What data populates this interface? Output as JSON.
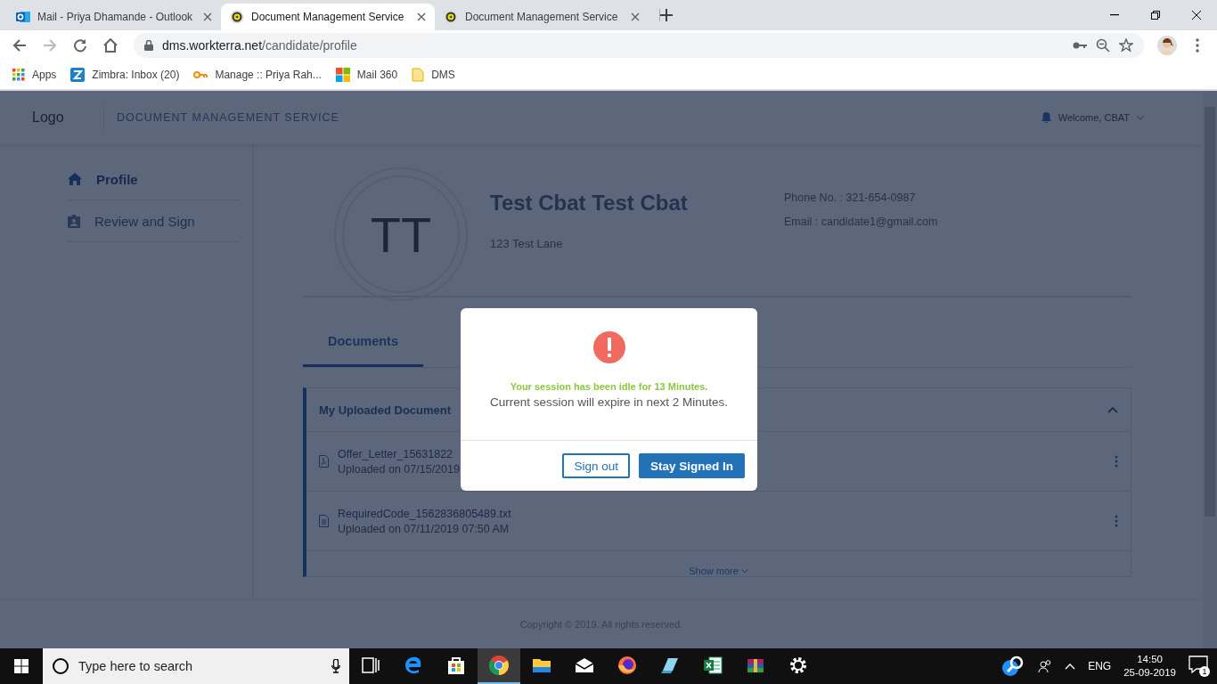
{
  "browser": {
    "tabs": [
      {
        "title": "Mail - Priya Dhamande - Outlook",
        "kind": "mail",
        "selected": false
      },
      {
        "title": "Document Management Service",
        "kind": "site",
        "selected": true
      },
      {
        "title": "Document Management Service",
        "kind": "site",
        "selected": false
      }
    ],
    "url": {
      "host": "dms.workterra.net",
      "path": "/candidate/profile"
    },
    "bookmarks": [
      {
        "label": "Apps",
        "kind": "apps"
      },
      {
        "label": "Zimbra: Inbox (20)",
        "kind": "tile"
      },
      {
        "label": "Manage :: Priya Rah...",
        "kind": "key"
      },
      {
        "label": "Mail 360",
        "kind": "squares"
      },
      {
        "label": "DMS",
        "kind": "folder"
      }
    ]
  },
  "header": {
    "logo_alt": "Logo",
    "title": "DOCUMENT MANAGEMENT SERVICE",
    "welcome": "Welcome, CBAT"
  },
  "sidebar": {
    "items": [
      {
        "label": "Profile",
        "kind": "home",
        "selected": true
      },
      {
        "label": "Review and Sign",
        "kind": "badge",
        "selected": false
      }
    ]
  },
  "profile": {
    "initials": "TT",
    "name": "Test Cbat Test Cbat",
    "address": "123 Test Lane",
    "phone": "Phone No. : 321-654-0987",
    "email": "Email : candidate1@gmail.com"
  },
  "tabs": [
    {
      "label": "Documents",
      "selected": true
    }
  ],
  "documents": {
    "title": "My Uploaded Document",
    "expanded": true,
    "files": [
      {
        "name": "Offer_Letter_15631822",
        "uploaded": "Uploaded on 07/15/2019",
        "kind": "pdf"
      },
      {
        "name": "RequiredCode_1562836805489.txt",
        "uploaded": "Uploaded on 07/11/2019 07:50 AM",
        "kind": "text"
      }
    ],
    "show_more": "Show more"
  },
  "footer": "Copyright © 2019. All rights reserved.",
  "modal": {
    "message": "Your session has been idle for 13 Minutes.",
    "detail": "Current session will expire in next 2 Minutes.",
    "buttons": [
      {
        "label": "Sign out",
        "kind": "secondary"
      },
      {
        "label": "Stay Signed In",
        "kind": "primary"
      }
    ]
  },
  "taskbar": {
    "search_placeholder": "Type here to search",
    "apps": [
      {
        "kind": "taskview",
        "selected": false
      },
      {
        "kind": "edge",
        "selected": false
      },
      {
        "kind": "store",
        "selected": false
      },
      {
        "kind": "chrome",
        "selected": true
      },
      {
        "kind": "explorer",
        "selected": false
      },
      {
        "kind": "mail",
        "selected": false
      },
      {
        "kind": "firefox",
        "selected": false
      },
      {
        "kind": "notes",
        "selected": false
      },
      {
        "kind": "excel",
        "selected": false
      },
      {
        "kind": "archive",
        "selected": false
      },
      {
        "kind": "settings",
        "selected": false
      }
    ],
    "language": "ENG",
    "time": "14:50",
    "date": "25-09-2019",
    "notifications": "1"
  }
}
